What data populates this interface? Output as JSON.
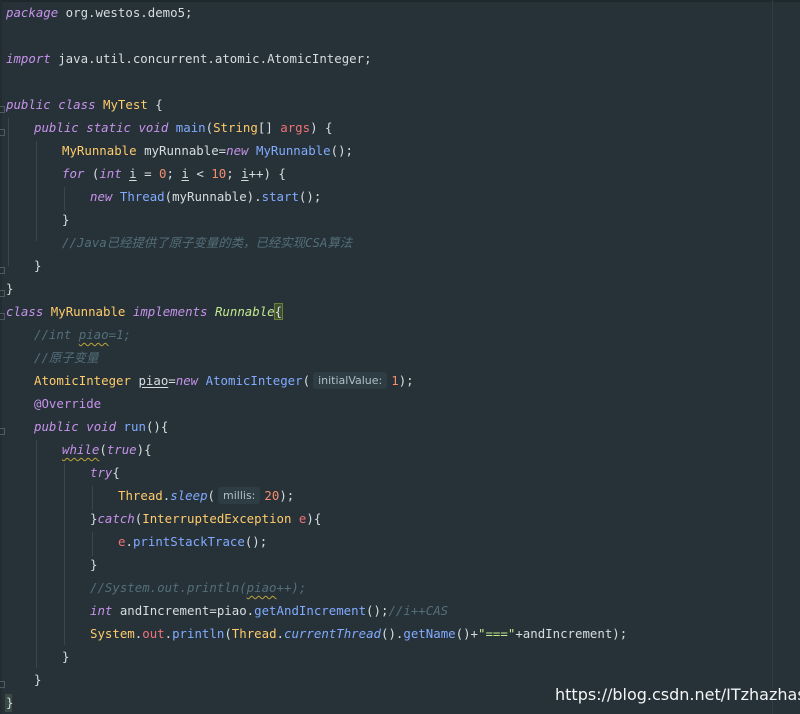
{
  "code_lines": {
    "l1": {
      "kw": "package",
      "rest": " org.westos.demo5;"
    },
    "l2": {
      "kw": "import",
      "rest": " java.util.concurrent.atomic.AtomicInteger;"
    },
    "l3": {
      "kw1": "public",
      "kw2": "class",
      "name": "MyTest",
      "rest": " {"
    },
    "l4": {
      "kw1": "public",
      "kw2": "static",
      "kw3": "void",
      "fn": "main",
      "open": "(",
      "type": "String",
      "arr": "[] ",
      "param": "args",
      "rest": ") {"
    },
    "l5": {
      "type": "MyRunnable",
      "var": " myRunnable=",
      "kw": "new",
      "cls": "MyRunnable",
      "rest": "();"
    },
    "l6": {
      "kw": "for",
      "p1": " (",
      "kw2": "int",
      "sp": " ",
      "i1": "i",
      "eq": " = ",
      "n0": "0",
      "semi": "; ",
      "i2": "i",
      "lt": " < ",
      "n10": "10",
      "semi2": "; ",
      "i3": "i",
      "rest": "++) {"
    },
    "l7": {
      "kw": "new",
      "cls": "Thread",
      "mid": "(myRunnable).",
      "fn": "start",
      "rest": "();"
    },
    "l8": {
      "text": "}"
    },
    "l9": {
      "comment": "//Java已经提供了原子变量的类，已经实现CSA算法"
    },
    "l10": {
      "text": "}"
    },
    "l11": {
      "text": "}"
    },
    "l12": {
      "kw": "class",
      "name": "MyRunnable",
      "kw2": "implements",
      "iface": "Runnable",
      "brace": "{"
    },
    "l13": {
      "c1": "//int ",
      "c2": "piao",
      "c3": "=1;"
    },
    "l14": {
      "comment": "//原子变量"
    },
    "l15": {
      "type": "AtomicInteger",
      "sp": " ",
      "var": "piao",
      "eq": "=",
      "kw": "new",
      "cls": "AtomicInteger",
      "open": "(",
      "hint": "initialValue:",
      "num": "1",
      "rest": ");"
    },
    "l16": {
      "anno": "@Override"
    },
    "l17": {
      "kw1": "public",
      "kw2": "void",
      "fn": "run",
      "rest": "(){"
    },
    "l18": {
      "kw": "while",
      "open": "(",
      "kw2": "true",
      "rest": "){"
    },
    "l19": {
      "kw": "try",
      "rest": "{"
    },
    "l20": {
      "type": "Thread",
      "dot": ".",
      "fn": "sleep",
      "open": "(",
      "hint": "millis:",
      "num": "20",
      "rest": ");"
    },
    "l21": {
      "b": "}",
      "kw": "catch",
      "open": "(",
      "type": "InterruptedException",
      "sp": " ",
      "param": "e",
      "rest": "){"
    },
    "l22": {
      "param": "e",
      "dot": ".",
      "fn": "printStackTrace",
      "rest": "();"
    },
    "l23": {
      "text": "}"
    },
    "l24": {
      "c1": "//System.out.println(",
      "c2": "piao",
      "c3": "++);"
    },
    "l25": {
      "kw": "int",
      "var": " andIncrement=piao.",
      "fn": "getAndIncrement",
      "mid": "();",
      "comment": "//i++CAS"
    },
    "l26": {
      "type": "System",
      "dot": ".",
      "field": "out",
      "dot2": ".",
      "fn": "println",
      "open": "(",
      "type2": "Thread",
      "dot3": ".",
      "fn2": "currentThread",
      "mid": "().",
      "fn3": "getName",
      "mid2": "()+",
      "str": "\"===\"",
      "rest": "+andIncrement);"
    },
    "l27": {
      "text": "}"
    },
    "l28": {
      "text": "}"
    },
    "l29": {
      "text": "}"
    }
  },
  "watermark": "https://blog.csdn.net/ITzhazhassc",
  "colors": {
    "background": "#263238",
    "keyword": "#c792ea",
    "type": "#ffcb6b",
    "function": "#82aaff",
    "number": "#f78c6c",
    "comment": "#546e7a"
  }
}
